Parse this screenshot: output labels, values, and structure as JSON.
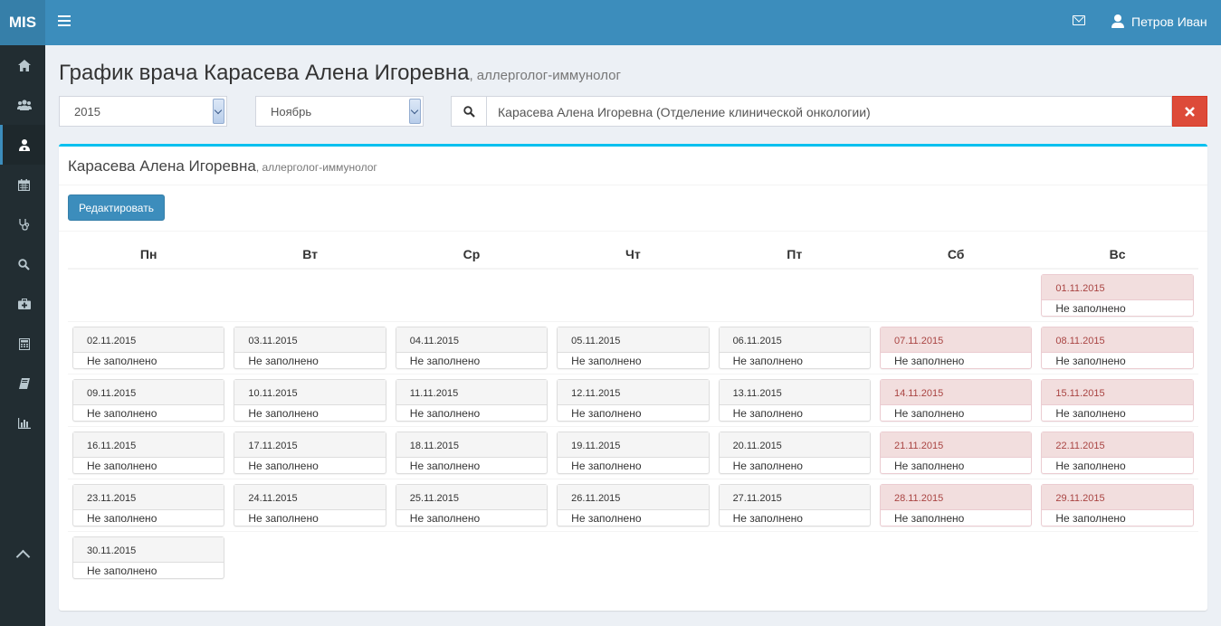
{
  "app": {
    "logo": "MIS"
  },
  "header": {
    "menu_icon": "bars-icon",
    "mail_icon": "envelope-icon",
    "user_name": "Петров Иван"
  },
  "sidebar": {
    "items": [
      {
        "icon": "home-icon"
      },
      {
        "icon": "users-icon"
      },
      {
        "icon": "user-md-icon",
        "active": true
      },
      {
        "icon": "calendar-icon"
      },
      {
        "icon": "stethoscope-icon"
      },
      {
        "icon": "search-icon"
      },
      {
        "icon": "medkit-icon"
      },
      {
        "icon": "calculator-icon"
      },
      {
        "icon": "book-icon"
      },
      {
        "icon": "bar-chart-icon"
      }
    ],
    "collapse_icon": "chevron-up-icon"
  },
  "page": {
    "title": "График врача Карасева Алена Игоревна",
    "subtitle": ", аллерголог-иммунолог"
  },
  "filters": {
    "year": "2015",
    "month": "Ноябрь",
    "doctor": "Карасева Алена Игоревна (Отделение клинической онкологии)"
  },
  "box": {
    "doctor_name": "Карасева Алена Игоревна",
    "specialty": ", аллерголог-иммунолог",
    "edit_label": "Редактировать"
  },
  "calendar": {
    "weekdays": [
      "Пн",
      "Вт",
      "Ср",
      "Чт",
      "Пт",
      "Сб",
      "Вс"
    ],
    "weeks": [
      [
        null,
        null,
        null,
        null,
        null,
        null,
        {
          "date": "01.11.2015",
          "status": "Не заполнено"
        }
      ],
      [
        {
          "date": "02.11.2015",
          "status": "Не заполнено"
        },
        {
          "date": "03.11.2015",
          "status": "Не заполнено"
        },
        {
          "date": "04.11.2015",
          "status": "Не заполнено"
        },
        {
          "date": "05.11.2015",
          "status": "Не заполнено"
        },
        {
          "date": "06.11.2015",
          "status": "Не заполнено"
        },
        {
          "date": "07.11.2015",
          "status": "Не заполнено"
        },
        {
          "date": "08.11.2015",
          "status": "Не заполнено"
        }
      ],
      [
        {
          "date": "09.11.2015",
          "status": "Не заполнено"
        },
        {
          "date": "10.11.2015",
          "status": "Не заполнено"
        },
        {
          "date": "11.11.2015",
          "status": "Не заполнено"
        },
        {
          "date": "12.11.2015",
          "status": "Не заполнено"
        },
        {
          "date": "13.11.2015",
          "status": "Не заполнено"
        },
        {
          "date": "14.11.2015",
          "status": "Не заполнено"
        },
        {
          "date": "15.11.2015",
          "status": "Не заполнено"
        }
      ],
      [
        {
          "date": "16.11.2015",
          "status": "Не заполнено"
        },
        {
          "date": "17.11.2015",
          "status": "Не заполнено"
        },
        {
          "date": "18.11.2015",
          "status": "Не заполнено"
        },
        {
          "date": "19.11.2015",
          "status": "Не заполнено"
        },
        {
          "date": "20.11.2015",
          "status": "Не заполнено"
        },
        {
          "date": "21.11.2015",
          "status": "Не заполнено"
        },
        {
          "date": "22.11.2015",
          "status": "Не заполнено"
        }
      ],
      [
        {
          "date": "23.11.2015",
          "status": "Не заполнено"
        },
        {
          "date": "24.11.2015",
          "status": "Не заполнено"
        },
        {
          "date": "25.11.2015",
          "status": "Не заполнено"
        },
        {
          "date": "26.11.2015",
          "status": "Не заполнено"
        },
        {
          "date": "27.11.2015",
          "status": "Не заполнено"
        },
        {
          "date": "28.11.2015",
          "status": "Не заполнено"
        },
        {
          "date": "29.11.2015",
          "status": "Не заполнено"
        }
      ],
      [
        {
          "date": "30.11.2015",
          "status": "Не заполнено"
        },
        null,
        null,
        null,
        null,
        null,
        null
      ]
    ]
  },
  "colors": {
    "topbar": "#3c8dbc",
    "sidebar": "#222d32",
    "accent": "#00c0ef",
    "danger": "#dd4b39",
    "weekend": "#f2dede"
  }
}
